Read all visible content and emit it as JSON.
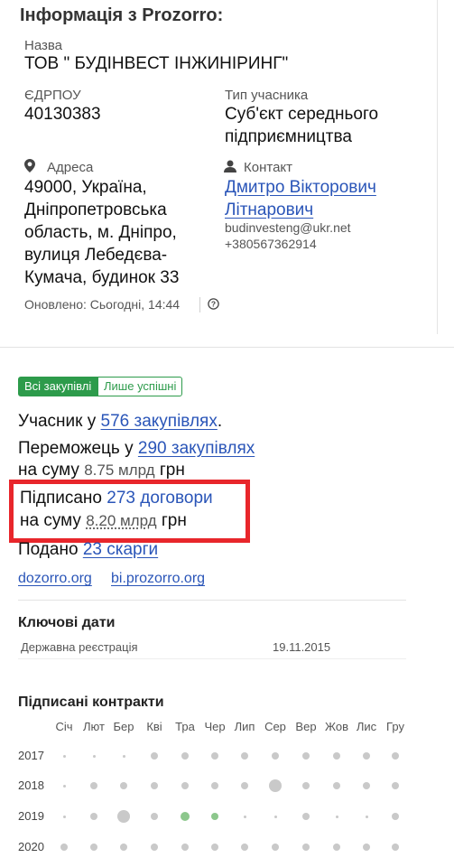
{
  "title": "Інформація з Prozorro:",
  "name_label": "Назва",
  "name_value": "ТОВ \" БУДІНВЕСТ ІНЖИНІРИНГ\"",
  "edrpou_label": "ЄДРПОУ",
  "edrpou_value": "40130383",
  "type_label": "Тип учасника",
  "type_value_1": "Суб'єкт середнього",
  "type_value_2": "підприємництва",
  "address_label": "Адреса",
  "address_lines": [
    "49000, Україна,",
    "Дніпропетровська",
    "область, м. Дніпро,",
    "вулиця Лебедєва-",
    "Кумача, будинок 33"
  ],
  "contact_label": "Контакт",
  "contact_name_1": "Дмитро Вікторович",
  "contact_name_2": "Літнарович",
  "contact_email": "budinvesteng@ukr.net",
  "contact_phone": "+380567362914",
  "updated": "Оновлено: Сьогодні, 14:44",
  "filters": {
    "all": "Всі закупівлі",
    "success": "Лише успішні"
  },
  "stats": {
    "participant_prefix": "Учасник у",
    "participant_link": "576 закупівлях",
    "participant_suffix": ".",
    "winner_prefix": "Переможець у",
    "winner_link": "290 закупівлях",
    "winner_sum_prefix": "на суму",
    "winner_sum": "8.75 млрд",
    "winner_sum_unit": "грн",
    "signed_prefix": "Підписано",
    "signed_link": "273 договори",
    "signed_sum_prefix": "на суму",
    "signed_sum": "8.20 млрд",
    "signed_sum_unit": "грн",
    "filed_prefix": "Подано",
    "filed_link": "23 скарги"
  },
  "links": [
    "dozorro.org",
    "bi.prozorro.org"
  ],
  "key_dates": {
    "title": "Ключові дати",
    "row_label": "Державна реєстрація",
    "row_value": "19.11.2015"
  },
  "contracts": {
    "title": "Підписані контракти",
    "months": [
      "Січ",
      "Лют",
      "Бер",
      "Кві",
      "Тра",
      "Чер",
      "Лип",
      "Сер",
      "Вер",
      "Жов",
      "Лис",
      "Гру"
    ],
    "years": [
      "2017",
      "2018",
      "2019",
      "2020"
    ],
    "dot_sizes": [
      [
        1,
        1,
        1,
        2,
        2,
        2,
        2,
        2,
        2,
        2,
        2,
        2
      ],
      [
        1,
        2,
        2,
        2,
        2,
        2,
        2,
        4,
        2,
        2,
        2,
        2
      ],
      [
        1,
        2,
        4,
        2,
        3,
        2,
        1,
        1,
        2,
        1,
        1,
        2
      ],
      [
        2,
        2,
        2,
        2,
        2,
        2,
        2,
        2,
        2,
        2,
        2,
        2
      ]
    ],
    "highlight_color": "#8cc78c",
    "dot_color": "#c9c9c9"
  },
  "colors": {
    "accent": "#2d9b4b",
    "link": "#2a55b8",
    "highlight_box": "#e8262b"
  }
}
